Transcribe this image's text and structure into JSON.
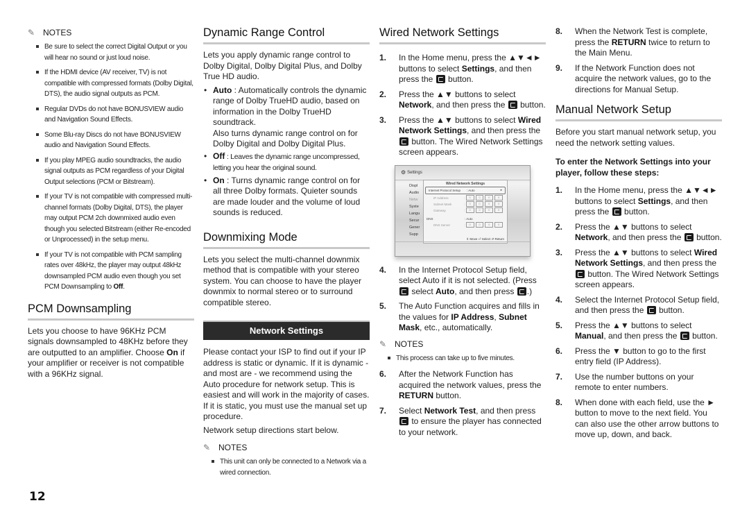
{
  "page_number": "12",
  "col1": {
    "notes_label": "NOTES",
    "notes": [
      "Be sure to select the correct Digital Output or you will hear no sound or just loud noise.",
      "If the HDMI device (AV receiver, TV) is not compatible with compressed formats (Dolby Digital, DTS), the audio signal outputs as PCM.",
      "Regular DVDs do not have BONUSVIEW audio and Navigation Sound Effects.",
      "Some Blu-ray Discs do not have BONUSVIEW audio and Navigation Sound Effects.",
      "If you play MPEG audio soundtracks, the audio signal outputs as PCM regardless of your Digital Output selections (PCM or Bitstream).",
      "If your TV is not compatible with compressed multi-channel formats (Dolby Digital, DTS), the player may output PCM 2ch downmixed audio even though you selected Bitstream (either Re-encoded or Unprocessed) in the setup menu."
    ],
    "note7_text": "If your TV is not compatible with PCM sampling rates over 48kHz, the player may output 48kHz downsampled PCM audio even though you set PCM Downsampling to ",
    "note7_bold": "Off",
    "note7_end": ".",
    "pcm_title": "PCM Downsampling",
    "pcm_text_1": "Lets you choose to have 96KHz PCM signals downsampled to 48KHz before they are outputted to an amplifier. Choose ",
    "pcm_bold": "On",
    "pcm_text_2": " if your amplifier or receiver is not compatible with a 96KHz signal."
  },
  "col2": {
    "drc_title": "Dynamic Range Control",
    "drc_intro": "Lets you apply dynamic range control to Dolby Digital, Dolby Digital Plus, and Dolby True HD audio.",
    "drc_auto_label": "Auto",
    "drc_auto_text": " : Automatically controls the dynamic range of Dolby TrueHD audio, based on information in the Dolby TrueHD soundtrack.",
    "drc_auto_text2": "Also turns dynamic range control on for Dolby Digital and Dolby Digital Plus.",
    "drc_off_label": "Off",
    "drc_off_text": " : Leaves the dynamic range uncompressed, letting you hear the original sound.",
    "drc_on_label": "On",
    "drc_on_text": " : Turns dynamic range control on for all three Dolby formats. Quieter sounds are made louder and the volume of loud sounds is reduced.",
    "downmix_title": "Downmixing Mode",
    "downmix_text": "Lets you select the multi-channel downmix method that is compatible with your stereo system. You can choose to have the player downmix to normal stereo or to surround compatible stereo.",
    "network_bar": "Network Settings",
    "network_text": "Please contact your ISP to find out if your IP address is static or dynamic. If it is dynamic - and most are - we recommend using the Auto procedure for network setup. This is easiest and will work in the majority of cases. If it is static, you must use the manual set up procedure.",
    "network_text2": "Network setup directions start below.",
    "notes_label": "NOTES",
    "notes": [
      "This unit can only be connected to a Network via a wired connection."
    ]
  },
  "col3": {
    "title": "Wired Network Settings",
    "step1_a": "In the Home menu, press the ▲▼◄► buttons to select ",
    "step1_b": "Settings",
    "step1_c": ", and then press the ",
    "step1_d": " button.",
    "step2_a": "Press the ▲▼ buttons to select ",
    "step2_b": "Network",
    "step2_c": ", and then press the ",
    "step2_d": " button.",
    "step3_a": "Press the ▲▼ buttons to select ",
    "step3_b": "Wired Network Settings",
    "step3_c": ", and then press the ",
    "step3_d": " button. The Wired Network Settings screen appears.",
    "screen": {
      "header": "Settings",
      "menu": [
        "Displ",
        "Audio",
        "Netw",
        "Syste",
        "Langu",
        "Secur",
        "Gener",
        "Supp"
      ],
      "dialog_title": "Wired Network Settings",
      "rows": [
        {
          "label": "Internet Protocol Setup",
          "value": ": Auto"
        },
        {
          "label": "IP Address",
          "value": ":"
        },
        {
          "label": "Subnet Mask",
          "value": ":"
        },
        {
          "label": "Gateway",
          "value": ":"
        },
        {
          "label": "DNS",
          "value": ": Auto"
        },
        {
          "label": "DNS Server",
          "value": ":"
        }
      ],
      "box_value": "0",
      "footer": "⇕ Move  ⏎ Select  ↺ Return"
    },
    "step4_a": "In the Internet Protocol Setup field, select Auto if it is not selected. (Press ",
    "step4_b": " select ",
    "step4_c": "Auto",
    "step4_d": ", and then press ",
    "step4_e": ".)",
    "step5_a": "The Auto Function acquires and fills in the values for ",
    "step5_b": "IP Address",
    "step5_c": ", ",
    "step5_d": "Subnet Mask",
    "step5_e": ", etc., automatically.",
    "notes_label": "NOTES",
    "notes": [
      "This process can take up to five minutes."
    ],
    "step6_a": "After the Network Function has acquired the network values, press the ",
    "step6_b": "RETURN",
    "step6_c": " button.",
    "step7_a": "Select ",
    "step7_b": "Network Test",
    "step7_c": ", and then press ",
    "step7_d": " to ensure the player has connected to your network."
  },
  "col4": {
    "step8_a": "When the Network Test is complete, press the ",
    "step8_b": "RETURN",
    "step8_c": " twice to return to the Main Menu.",
    "step9": "If the Network Function does not acquire the network values, go to the directions for Manual Setup.",
    "manual_title": "Manual Network Setup",
    "manual_intro": "Before you start manual network setup, you need the network setting values.",
    "manual_subhead": "To enter the Network Settings into your player, follow these steps:",
    "m1_a": "In the Home menu, press the ▲▼◄► buttons to select ",
    "m1_b": "Settings",
    "m1_c": ", and then press the ",
    "m1_d": " button.",
    "m2_a": "Press the ▲▼ buttons to select ",
    "m2_b": "Network",
    "m2_c": ", and then press the ",
    "m2_d": " button.",
    "m3_a": "Press the ▲▼ buttons to select ",
    "m3_b": "Wired Network Settings",
    "m3_c": ", and then press the ",
    "m3_d": " button. The Wired Network Settings screen appears.",
    "m4_a": "Select the Internet Protocol Setup field, and then press the ",
    "m4_b": " button.",
    "m5_a": "Press the ▲▼ buttons to select ",
    "m5_b": "Manual",
    "m5_c": ", and then press the ",
    "m5_d": " button.",
    "m6": "Press the ▼ button to go to the first entry field (IP Address).",
    "m7": "Use the number buttons on your remote to enter numbers.",
    "m8": "When done with each field, use the ► button to move to the next field. You can also use the other arrow buttons to move up, down, and back."
  },
  "step_numbers": [
    "1.",
    "2.",
    "3.",
    "4.",
    "5.",
    "6.",
    "7.",
    "8.",
    "9."
  ]
}
